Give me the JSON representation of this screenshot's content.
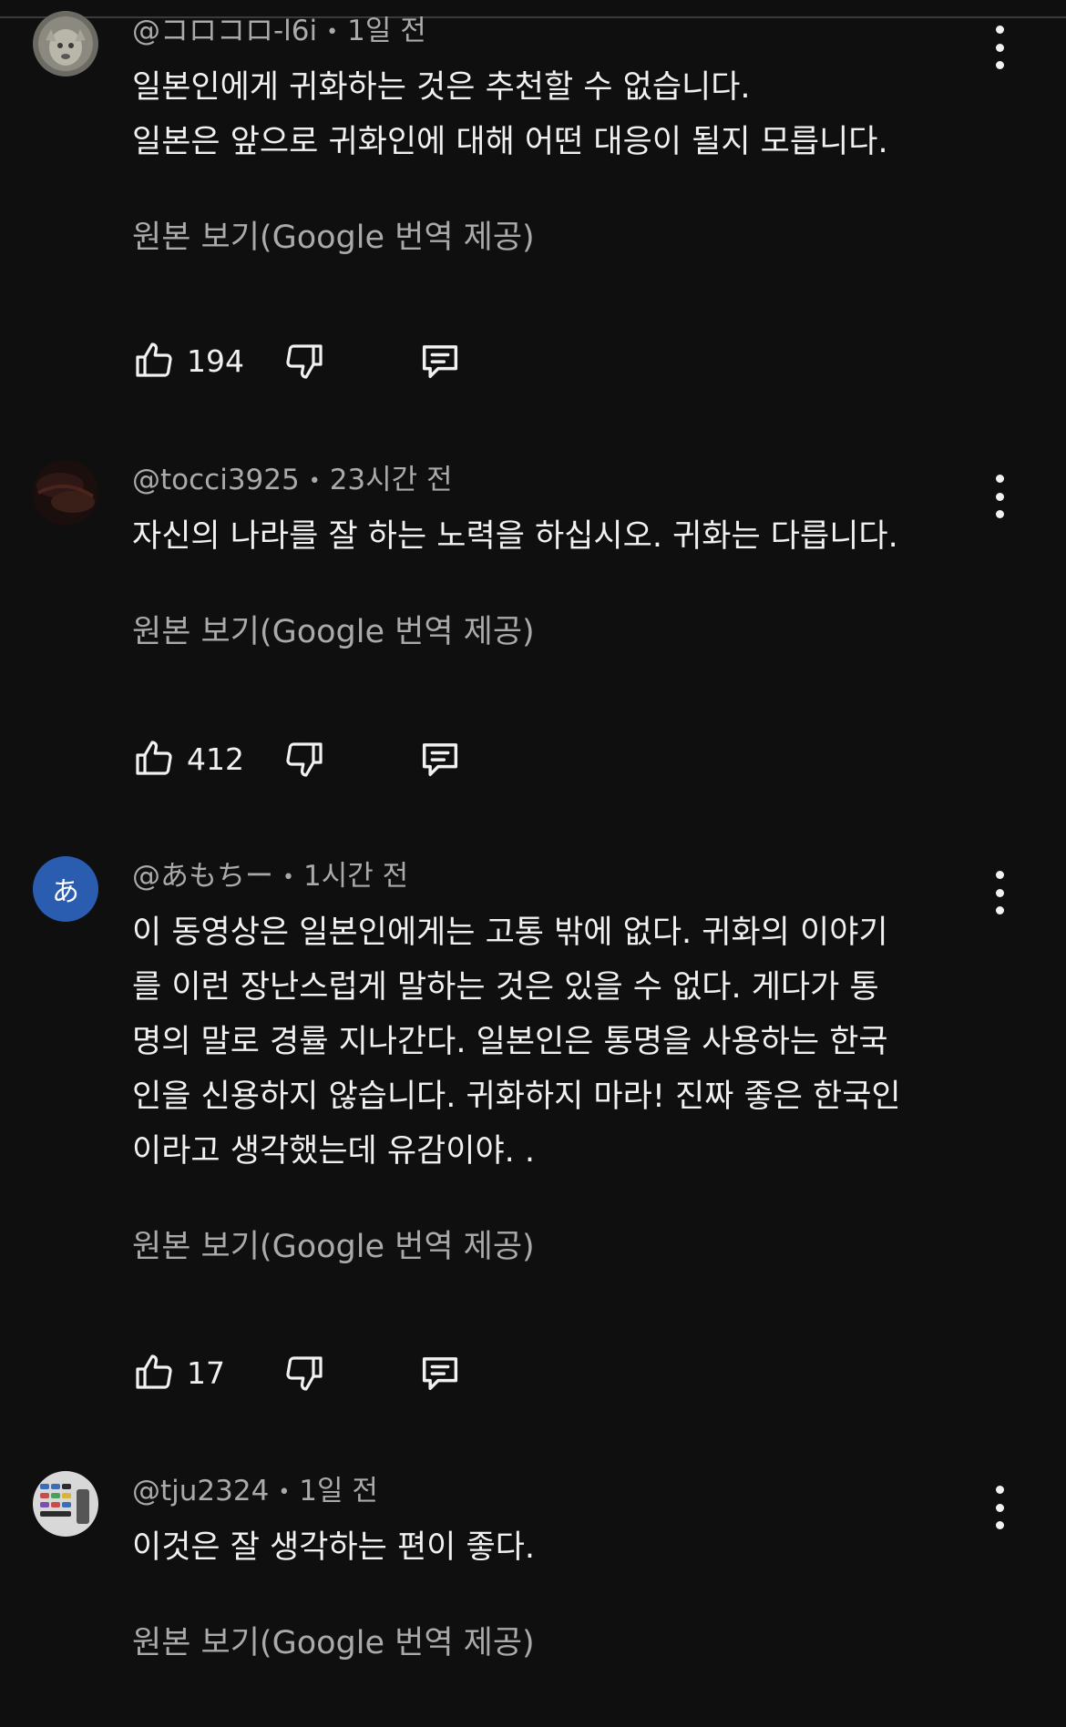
{
  "comments": [
    {
      "handle": "@コロコロ-l6i",
      "time": "1일 전",
      "text": "일본인에게 귀화하는 것은 추천할 수 없습니다.\n일본은 앞으로 귀화인에 대해 어떤 대응이 될지 모릅니다.",
      "translate_label": "원본 보기(Google 번역 제공)",
      "likes": "194",
      "avatar_icon": "cat-photo-avatar"
    },
    {
      "handle": "@tocci3925",
      "time": "23시간 전",
      "text": "자신의 나라를 잘 하는 노력을 하십시오. 귀화는 다릅니다.",
      "translate_label": "원본 보기(Google 번역 제공)",
      "likes": "412",
      "avatar_icon": "dark-photo-avatar"
    },
    {
      "handle": "@あもちー",
      "time": "1시간 전",
      "avatar_letter": "あ",
      "text": "이 동영상은 일본인에게는 고통 밖에 없다. 귀화의 이야기\n를 이런 장난스럽게 말하는 것은 있을 수 없다. 게다가 통\n명의 말로 경률 지나간다. 일본인은 통명을 사용하는 한국\n인을 신용하지 않습니다. 귀화하지 마라! 진짜 좋은 한국인\n이라고 생각했는데 유감이야. .",
      "translate_label": "원본 보기(Google 번역 제공)",
      "likes": "17"
    },
    {
      "handle": "@tju2324",
      "time": "1일 전",
      "text": "이것은 잘 생각하는 편이 좋다.",
      "translate_label": "원본 보기(Google 번역 제공)",
      "avatar_icon": "keyboard-photo-avatar"
    }
  ],
  "colors": {
    "background": "#0f0f0f",
    "text": "#f1f1f1",
    "secondary": "#aaaaaa",
    "avatar_letter_bg": "#2a5db0"
  },
  "icons": [
    "thumbs-up-icon",
    "thumbs-down-icon",
    "reply-icon",
    "more-vert-icon"
  ],
  "separator": "•"
}
